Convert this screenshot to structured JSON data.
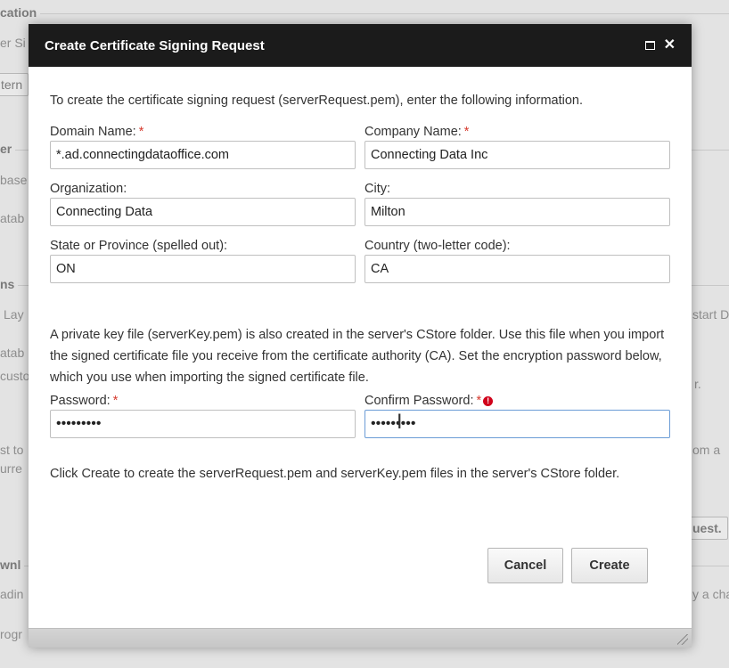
{
  "background": {
    "sections": [
      "cation",
      "er",
      "ns",
      "wnl"
    ],
    "fragments": [
      "er Si",
      "tern",
      "base",
      "atab",
      "Lay",
      "atab",
      "custo",
      "st to",
      "urre",
      "adin",
      "rogr",
      "start D",
      "r.",
      "om a",
      "uest.",
      "y a cha"
    ]
  },
  "dialog": {
    "title": "Create Certificate Signing Request",
    "intro": "To create the certificate signing request (serverRequest.pem), enter the following information.",
    "fields": {
      "domain_label": "Domain Name:",
      "domain_value": "*.ad.connectingdataoffice.com",
      "company_label": "Company Name:",
      "company_value": "Connecting Data Inc",
      "org_label": "Organization:",
      "org_value": "Connecting Data",
      "city_label": "City:",
      "city_value": "Milton",
      "state_label": "State or Province (spelled out):",
      "state_value": "ON",
      "country_label": "Country (two-letter code):",
      "country_value": "CA"
    },
    "key_paragraph": "A private key file (serverKey.pem) is also created in the server's CStore folder. Use this file when you import the signed certificate file you receive from the certificate authority (CA). Set the encryption password below, which you use when importing the signed certificate file.",
    "password_label": "Password:",
    "password_value": "•••••••••",
    "confirm_label": "Confirm Password:",
    "confirm_value": "•••••••••",
    "create_paragraph": "Click Create to create the serverRequest.pem and serverKey.pem files in the server's CStore folder.",
    "cancel_label": "Cancel",
    "create_label": "Create",
    "required_mark": "*",
    "error_mark": "!"
  }
}
